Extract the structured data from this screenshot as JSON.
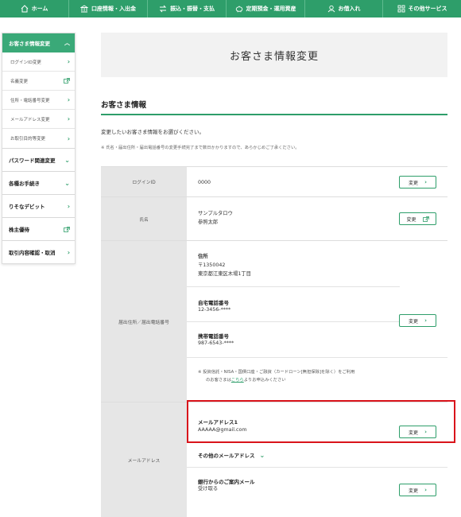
{
  "topnav": {
    "items": [
      {
        "label": "ホーム",
        "icon": "home-icon"
      },
      {
        "label": "口座情報・入出金",
        "icon": "building-icon"
      },
      {
        "label": "振込・振替・支払",
        "icon": "transfer-icon"
      },
      {
        "label": "定期預金・運用資産",
        "icon": "piggybank-icon"
      },
      {
        "label": "お借入れ",
        "icon": "loan-icon"
      },
      {
        "label": "その他サービス",
        "icon": "grid-icon"
      }
    ],
    "color": "#2e9e6a"
  },
  "sidebar": {
    "header": "お客さま情報変更",
    "sub_items": [
      {
        "label": "ログインID変更",
        "icon": "chevron-right-icon"
      },
      {
        "label": "名義変更",
        "icon": "external-link-icon"
      },
      {
        "label": "住所・電話番号変更",
        "icon": "chevron-right-icon"
      },
      {
        "label": "メールアドレス変更",
        "icon": "chevron-right-icon"
      },
      {
        "label": "お取引目的等変更",
        "icon": "chevron-right-icon"
      }
    ],
    "main_items": [
      {
        "label": "パスワード関連変更",
        "icon": "chevron-down-icon"
      },
      {
        "label": "各種お手続き",
        "icon": "chevron-down-icon"
      },
      {
        "label": "りそなデビット",
        "icon": "chevron-right-icon"
      },
      {
        "label": "株主優待",
        "icon": "external-link-icon"
      },
      {
        "label": "取引内容確認・取消",
        "icon": "chevron-right-icon"
      }
    ]
  },
  "page": {
    "title": "お客さま情報変更",
    "section_title": "お客さま情報",
    "intro": "変更したいお客さま情報をお選びください。",
    "note": "※ 氏名・届出住所・届出電話番号の変更手続完了まで数日かかりますので、あらかじめご了承ください。"
  },
  "table": {
    "login": {
      "label": "ログインID",
      "value": "0000",
      "button": "変更"
    },
    "name": {
      "label": "氏名",
      "kana": "サンプルタロウ",
      "kanji": "参照太郎",
      "button": "変更"
    },
    "address": {
      "label": "届出住所／届出電話番号",
      "addr_label": "住所",
      "postal": "〒1350042",
      "addr": "東京都江東区木場1丁目",
      "home_label": "自宅電話番号",
      "home_value": "12-3456-****",
      "mobile_label": "携帯電話番号",
      "mobile_value": "987-6543-****",
      "button": "変更",
      "note_line1": "※ 投資信託・NISA・国債口座・ご融資（カードローン[無担保除]を除く）をご利用",
      "note_prefix": "のお客さまは",
      "note_link": "こちら",
      "note_suffix": "よりお申込みください"
    },
    "email": {
      "label": "メールアドレス",
      "email1_label": "メールアドレス1",
      "email1_value": "AAAAA@gmail.com",
      "button": "変更",
      "other_label": "その他のメールアドレス",
      "bank_label": "銀行からのご案内メール",
      "bank_value": "受け取る",
      "button2": "変更"
    }
  },
  "colors": {
    "accent": "#2e9e6a",
    "highlight": "#d9141b"
  }
}
